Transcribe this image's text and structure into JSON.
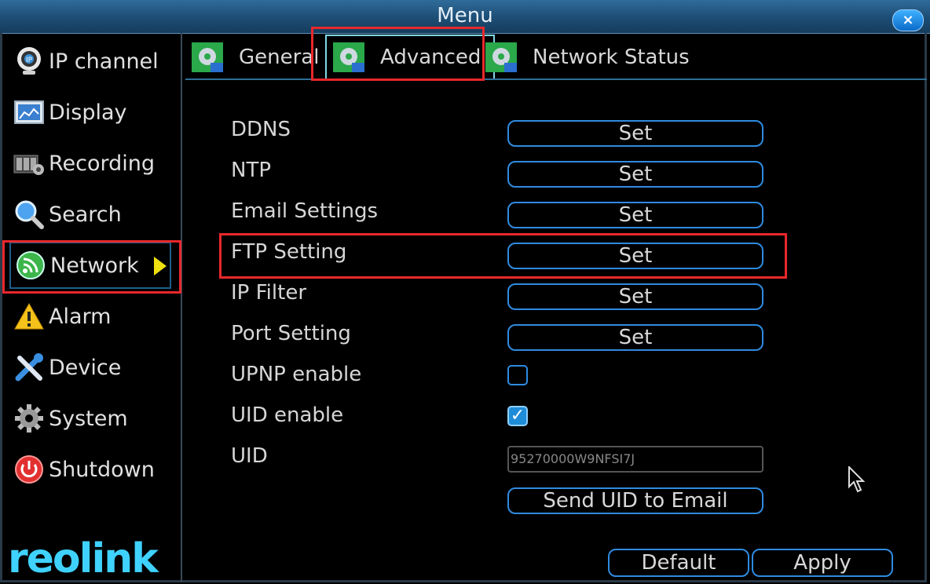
{
  "window": {
    "title": "Menu",
    "close_label": "×"
  },
  "sidebar": {
    "items": [
      {
        "label": "IP channel",
        "icon": "webcam-icon"
      },
      {
        "label": "Display",
        "icon": "display-icon"
      },
      {
        "label": "Recording",
        "icon": "film-icon"
      },
      {
        "label": "Search",
        "icon": "magnifier-icon"
      },
      {
        "label": "Network",
        "icon": "network-icon",
        "active": true
      },
      {
        "label": "Alarm",
        "icon": "warning-icon"
      },
      {
        "label": "Device",
        "icon": "tools-icon"
      },
      {
        "label": "System",
        "icon": "gear-icon"
      },
      {
        "label": "Shutdown",
        "icon": "power-icon"
      }
    ],
    "logo": "reolink"
  },
  "tabs": [
    {
      "label": "General",
      "icon": "settings-icon"
    },
    {
      "label": "Advanced",
      "icon": "settings-icon",
      "active": true
    },
    {
      "label": "Network Status",
      "icon": "settings-icon"
    }
  ],
  "settings": {
    "ddns": {
      "label": "DDNS",
      "button": "Set"
    },
    "ntp": {
      "label": "NTP",
      "button": "Set"
    },
    "email": {
      "label": "Email Settings",
      "button": "Set"
    },
    "ftp": {
      "label": "FTP Setting",
      "button": "Set"
    },
    "ip_filter": {
      "label": "IP Filter",
      "button": "Set"
    },
    "port": {
      "label": "Port Setting",
      "button": "Set"
    },
    "upnp": {
      "label": "UPNP enable",
      "checked": false
    },
    "uid_enable": {
      "label": "UID enable",
      "checked": true,
      "check_mark": "✓"
    },
    "uid": {
      "label": "UID",
      "value": "95270000W9NFSI7J"
    },
    "send_uid_button": "Send UID to Email"
  },
  "footer": {
    "default_label": "Default",
    "apply_label": "Apply"
  },
  "colors": {
    "accent": "#2f8be0",
    "highlight": "#e8282c",
    "titlebar": "#1d4d74"
  }
}
